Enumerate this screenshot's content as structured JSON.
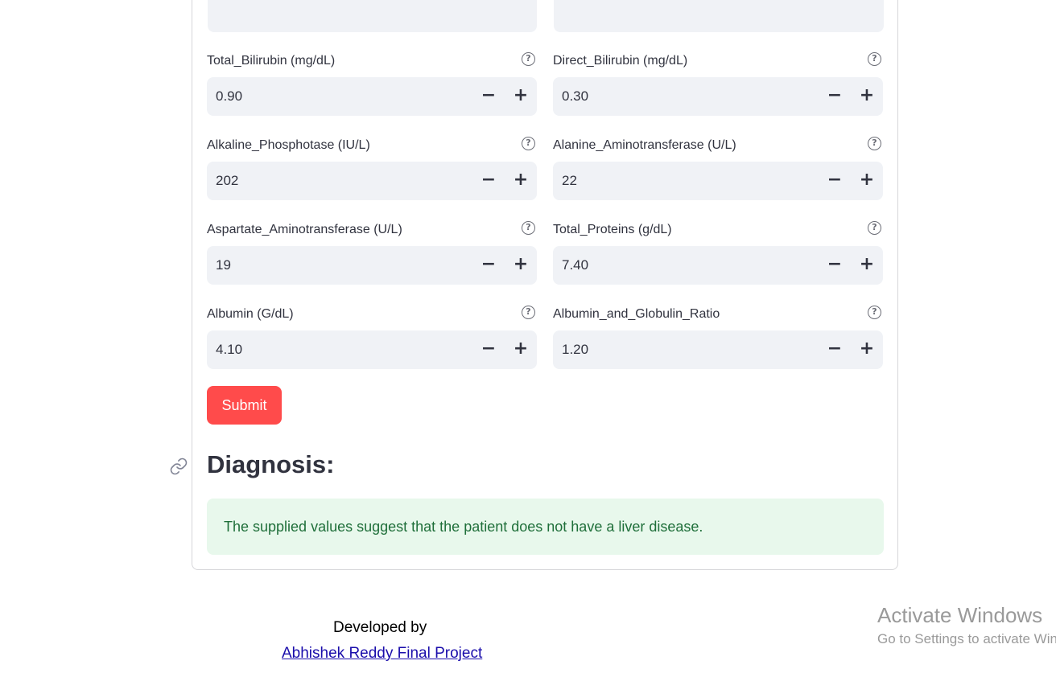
{
  "fields": [
    {
      "label": "Total_Bilirubin (mg/dL)",
      "value": "0.90"
    },
    {
      "label": "Direct_Bilirubin (mg/dL)",
      "value": "0.30"
    },
    {
      "label": "Alkaline_Phosphotase (IU/L)",
      "value": "202"
    },
    {
      "label": "Alanine_Aminotransferase (U/L)",
      "value": "22"
    },
    {
      "label": "Aspartate_Aminotransferase (U/L)",
      "value": "19"
    },
    {
      "label": "Total_Proteins (g/dL)",
      "value": "7.40"
    },
    {
      "label": "Albumin (G/dL)",
      "value": "4.10"
    },
    {
      "label": "Albumin_and_Globulin_Ratio",
      "value": "1.20"
    }
  ],
  "help_icon": "question-circle-icon",
  "stepper": {
    "minus": "−",
    "plus": "+"
  },
  "submit_label": "Submit",
  "diagnosis": {
    "heading": "Diagnosis:",
    "result": "The supplied values suggest that the patient does not have a liver disease."
  },
  "footer": {
    "developed_by": "Developed by",
    "link_text": "Abhishek Reddy Final Project"
  },
  "watermark": {
    "title": "Activate Windows",
    "subtitle": "Go to Settings to activate Windows."
  },
  "colors": {
    "accent": "#ff4b4b",
    "success_bg": "#e8f8ec",
    "success_text": "#1f6f3a",
    "input_bg": "#f0f2f6"
  }
}
